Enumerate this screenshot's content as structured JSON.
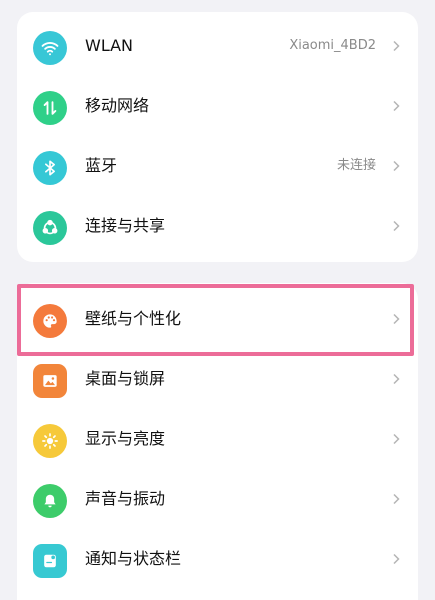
{
  "colors": {
    "wlan_icon": "#38c7d6",
    "mobile_icon": "#2fd089",
    "bluetooth_icon": "#35c8d5",
    "share_icon": "#2bc79a",
    "wallpaper_icon": "#f47a3c",
    "desktop_icon": "#f2853a",
    "display_icon": "#f6c93a",
    "sound_icon": "#3dcc6a",
    "notification_icon": "#37c9d2",
    "highlight_border": "#ec6c98"
  },
  "connections": {
    "wlan": {
      "label": "WLAN",
      "value": "Xiaomi_4BD2",
      "icon": "wifi-icon"
    },
    "mobile": {
      "label": "移动网络",
      "icon": "mobile-data-icon"
    },
    "bluetooth": {
      "label": "蓝牙",
      "value": "未连接",
      "icon": "bluetooth-icon"
    },
    "share": {
      "label": "连接与共享",
      "icon": "share-icon"
    }
  },
  "personalization": {
    "wallpaper": {
      "label": "壁纸与个性化",
      "icon": "palette-icon"
    },
    "desktop": {
      "label": "桌面与锁屏",
      "icon": "image-icon"
    },
    "display": {
      "label": "显示与亮度",
      "icon": "sun-icon"
    },
    "sound": {
      "label": "声音与振动",
      "icon": "bell-icon"
    },
    "notification": {
      "label": "通知与状态栏",
      "icon": "notification-icon"
    }
  }
}
